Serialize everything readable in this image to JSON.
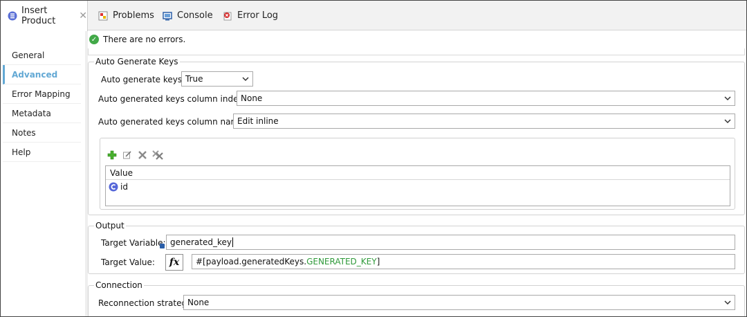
{
  "tabs": [
    {
      "label": "Insert Product",
      "icon": "database-icon",
      "active": true
    },
    {
      "label": "Problems",
      "icon": "problems-icon"
    },
    {
      "label": "Console",
      "icon": "console-icon"
    },
    {
      "label": "Error Log",
      "icon": "error-log-icon"
    }
  ],
  "sidebar": {
    "items": [
      {
        "label": "General"
      },
      {
        "label": "Advanced",
        "active": true
      },
      {
        "label": "Error Mapping"
      },
      {
        "label": "Metadata"
      },
      {
        "label": "Notes"
      },
      {
        "label": "Help"
      }
    ]
  },
  "status": {
    "text": "There are no errors."
  },
  "auto_generate": {
    "title": "Auto Generate Keys",
    "keys_label": "Auto generate keys:",
    "keys_value": "True",
    "indexes_label": "Auto generated keys column indexes",
    "indexes_value": "None",
    "names_label": "Auto generated keys column names",
    "names_value": "Edit inline",
    "table": {
      "header": "Value",
      "rows": [
        {
          "value": "id"
        }
      ]
    }
  },
  "output": {
    "title": "Output",
    "target_variable_label": "Target Variable:",
    "target_variable_value": "generated_key",
    "target_value_label": "Target Value:",
    "fx_label": "fx",
    "target_value_prefix": "#[payload.generatedKeys.",
    "target_value_highlight": "GENERATED_KEY",
    "target_value_suffix": "]"
  },
  "connection": {
    "title": "Connection",
    "strategy_label": "Reconnection strategy",
    "strategy_value": "None"
  },
  "colors": {
    "accent": "#62a8d4",
    "ok_green": "#42a948",
    "mel_green": "#2f9a3a"
  }
}
